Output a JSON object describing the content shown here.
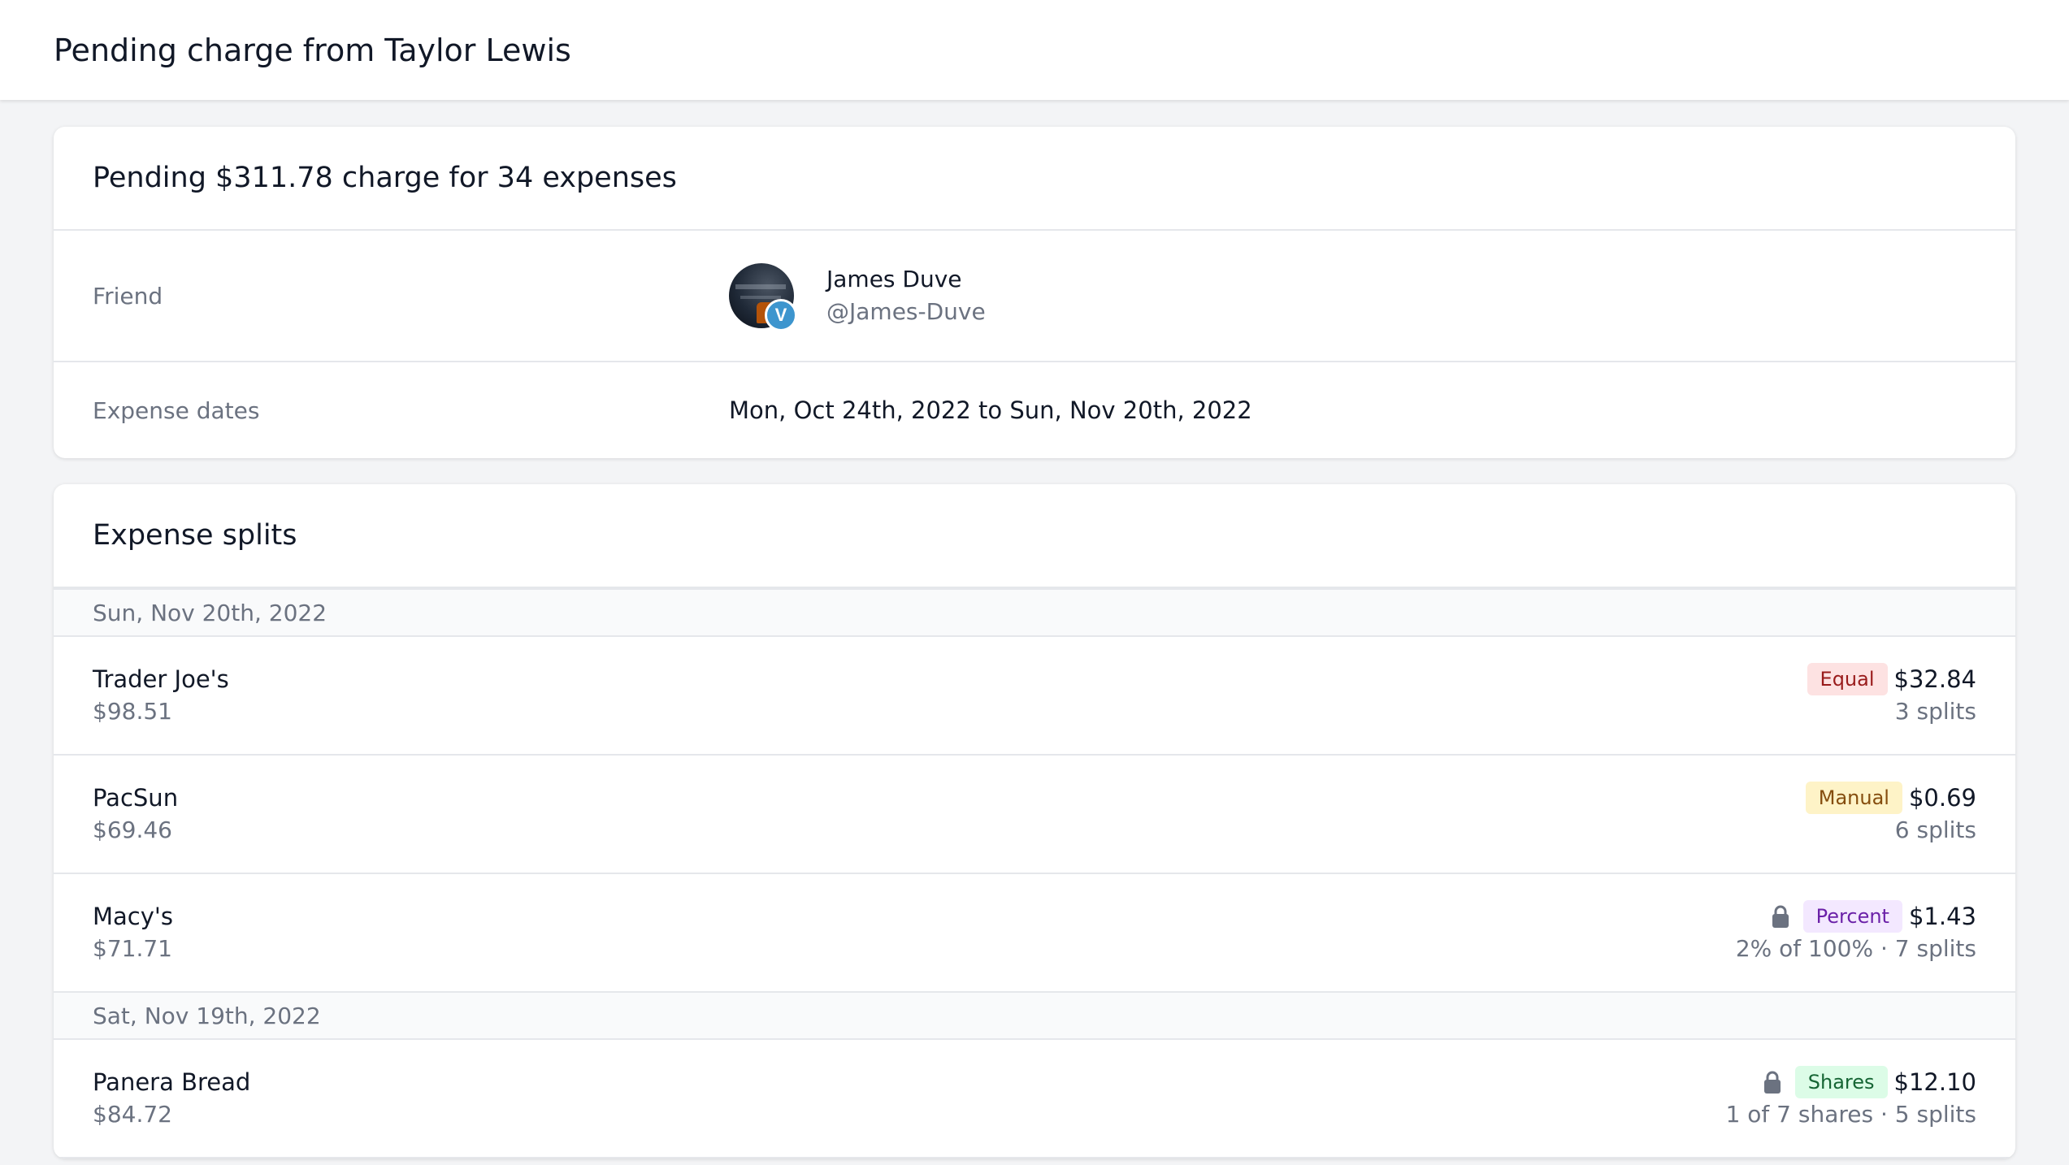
{
  "header": {
    "title": "Pending charge from Taylor Lewis"
  },
  "summary": {
    "title": "Pending $311.78 charge for 34 expenses",
    "friend_label": "Friend",
    "friend_name": "James Duve",
    "friend_handle": "@James-Duve",
    "venmo_badge": "V",
    "dates_label": "Expense dates",
    "dates_value": "Mon, Oct 24th, 2022 to Sun, Nov 20th, 2022"
  },
  "splits": {
    "title": "Expense splits",
    "groups": [
      {
        "date": "Sun, Nov 20th, 2022",
        "items": [
          {
            "name": "Trader Joe's",
            "total": "$98.51",
            "type": "Equal",
            "amount": "$32.84",
            "detail": "3 splits",
            "locked": false
          },
          {
            "name": "PacSun",
            "total": "$69.46",
            "type": "Manual",
            "amount": "$0.69",
            "detail": "6 splits",
            "locked": false
          },
          {
            "name": "Macy's",
            "total": "$71.71",
            "type": "Percent",
            "amount": "$1.43",
            "detail": "2% of 100% · 7 splits",
            "locked": true
          }
        ]
      },
      {
        "date": "Sat, Nov 19th, 2022",
        "items": [
          {
            "name": "Panera Bread",
            "total": "$84.72",
            "type": "Shares",
            "amount": "$12.10",
            "detail": "1 of 7 shares · 5 splits",
            "locked": true
          }
        ]
      }
    ]
  },
  "icons": {
    "lock": "lock-icon",
    "venmo": "venmo-icon"
  },
  "colors": {
    "equal_bg": "#fde2e2",
    "manual_bg": "#fef3c7",
    "percent_bg": "#f3e8ff",
    "shares_bg": "#dcfce7",
    "venmo_blue": "#3d95ce"
  }
}
